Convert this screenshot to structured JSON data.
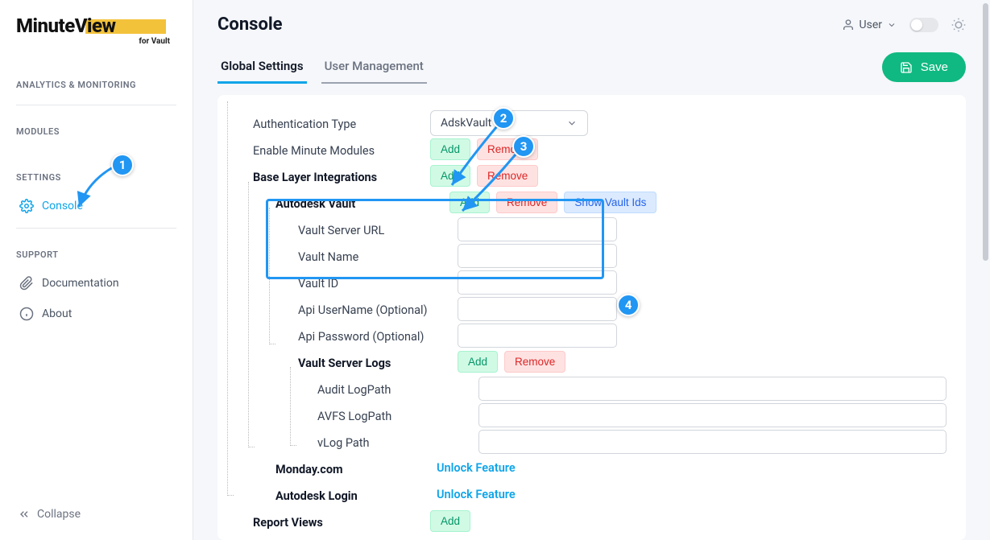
{
  "logo": {
    "main1": "Minute",
    "main2": "View",
    "sub": "for Vault"
  },
  "sidebar": {
    "sections": {
      "analytics": "ANALYTICS & MONITORING",
      "modules": "MODULES",
      "settings": "SETTINGS",
      "support": "SUPPORT"
    },
    "console": "Console",
    "documentation": "Documentation",
    "about": "About",
    "collapse": "Collapse"
  },
  "header": {
    "title": "Console",
    "user": "User"
  },
  "tabs": {
    "global": "Global Settings",
    "user_mgmt": "User Management"
  },
  "actions": {
    "save": "Save",
    "add": "Add",
    "remove": "Remove",
    "show_vault_ids": "Show Vault Ids",
    "unlock": "Unlock Feature"
  },
  "form": {
    "auth_type": "Authentication Type",
    "auth_value": "AdskVault",
    "enable_minute_modules": "Enable Minute Modules",
    "base_layer": "Base Layer Integrations",
    "autodesk_vault": "Autodesk Vault",
    "vault_server_url": "Vault Server URL",
    "vault_name": "Vault Name",
    "vault_id": "Vault ID",
    "api_username": "Api UserName (Optional)",
    "api_password": "Api Password (Optional)",
    "vault_server_logs": "Vault Server Logs",
    "audit_logpath": "Audit LogPath",
    "avfs_logpath": "AVFS LogPath",
    "vlog_path": "vLog Path",
    "monday": "Monday.com",
    "autodesk_login": "Autodesk Login",
    "report_views": "Report Views"
  },
  "callouts": {
    "c1": "1",
    "c2": "2",
    "c3": "3",
    "c4": "4"
  }
}
